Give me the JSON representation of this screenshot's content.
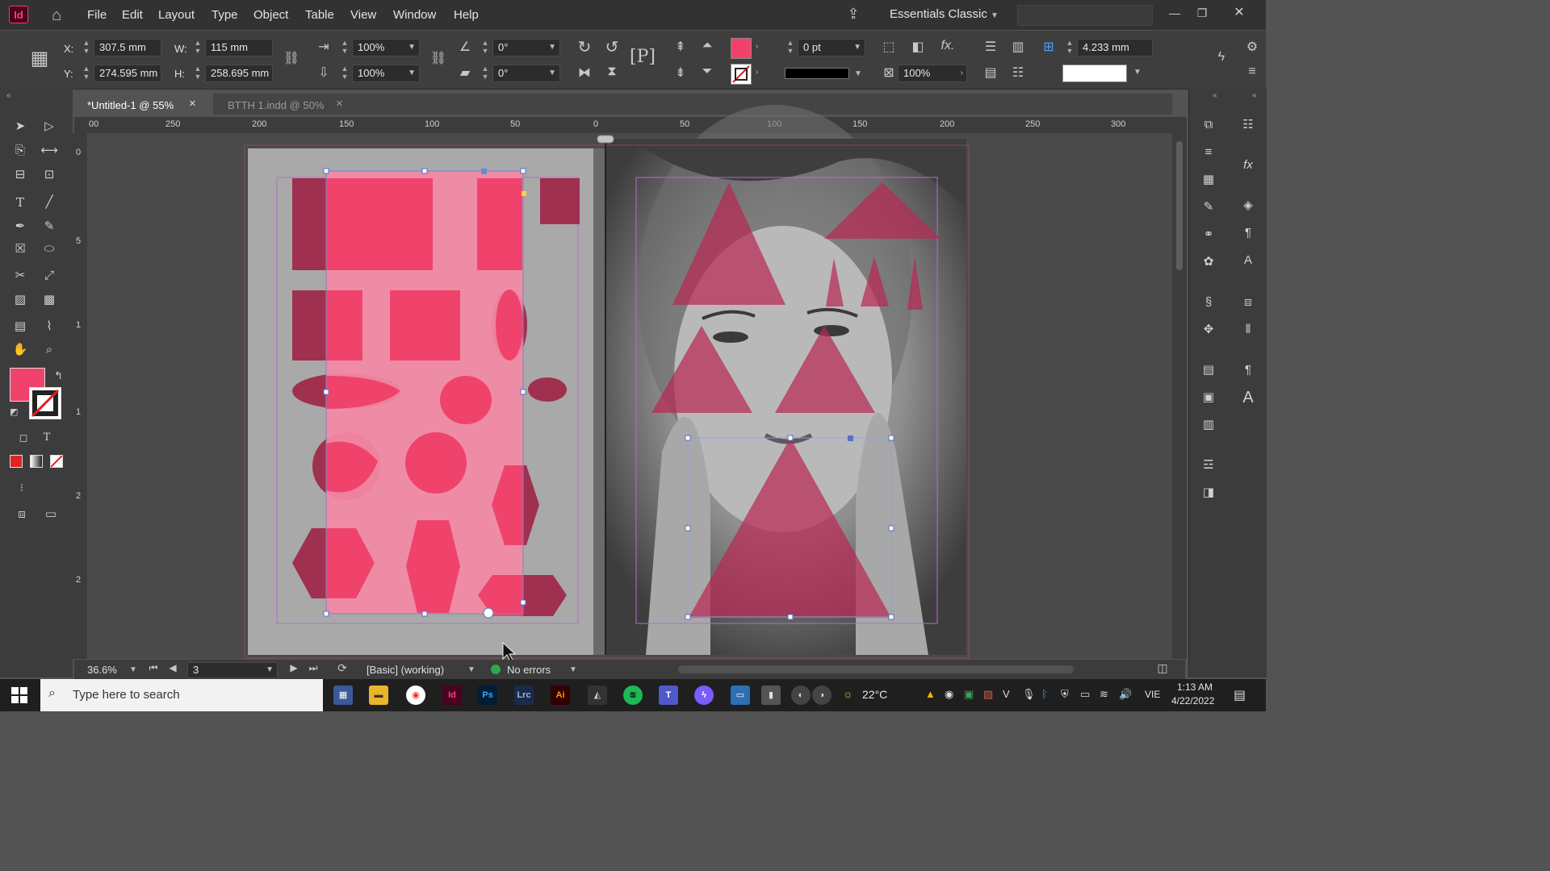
{
  "app": {
    "logo": "Id"
  },
  "menu": [
    "File",
    "Edit",
    "Layout",
    "Type",
    "Object",
    "Table",
    "View",
    "Window",
    "Help"
  ],
  "workspace": "Essentials Classic",
  "control": {
    "x_label": "X:",
    "x_value": "307.5 mm",
    "y_label": "Y:",
    "y_value": "274.595 mm",
    "w_label": "W:",
    "w_value": "115 mm",
    "h_label": "H:",
    "h_value": "258.695 mm",
    "scale_x": "100%",
    "scale_y": "100%",
    "rotate": "0°",
    "shear": "0°",
    "stroke_weight": "0 pt",
    "opacity": "100%",
    "gap": "4.233 mm",
    "fill_color": "#f0436c"
  },
  "tabs": [
    {
      "label": "*Untitled-1 @ 55%",
      "close": "×"
    },
    {
      "label": "BTTH 1.indd @ 50%",
      "close": "×"
    }
  ],
  "ruler_labels": [
    "00",
    "250",
    "200",
    "150",
    "100",
    "50",
    "0",
    "50",
    "100",
    "150",
    "200",
    "250",
    "300"
  ],
  "vruler_labels": [
    "0",
    "5",
    "1",
    "1",
    "2",
    "2"
  ],
  "status": {
    "zoom": "36.6%",
    "page": "3",
    "preflight_profile": "[Basic] (working)",
    "preflight_status": "No errors"
  },
  "taskbar": {
    "search_placeholder": "Type here to search",
    "weather": "22°C",
    "language": "VIE",
    "time": "1:13 AM",
    "date": "4/22/2022"
  },
  "colors": {
    "accent_pink": "#f0436c",
    "dark_pink": "#9e2f4f",
    "frame_pink": "#f48aa6"
  }
}
